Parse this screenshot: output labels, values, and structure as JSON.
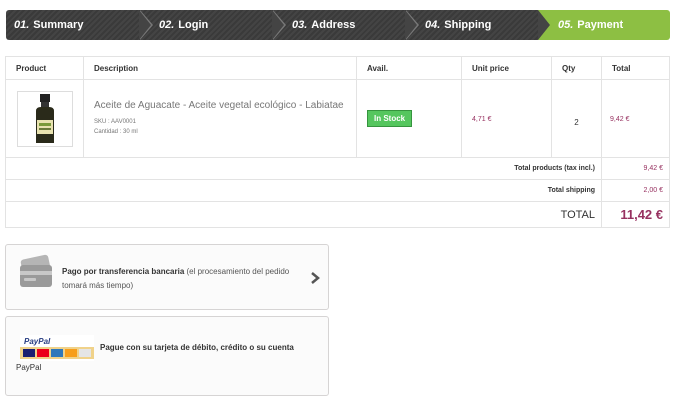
{
  "steps": [
    {
      "num": "01.",
      "label": "Summary"
    },
    {
      "num": "02.",
      "label": "Login"
    },
    {
      "num": "03.",
      "label": "Address"
    },
    {
      "num": "04.",
      "label": "Shipping"
    },
    {
      "num": "05.",
      "label": "Payment"
    }
  ],
  "colors": {
    "active_step": "#8dbf43",
    "price": "#973160",
    "stock": "#55c65e"
  },
  "table": {
    "headers": {
      "product": "Product",
      "description": "Description",
      "avail": "Avail.",
      "unit_price": "Unit price",
      "qty": "Qty",
      "total": "Total"
    },
    "item": {
      "name": "Aceite de Aguacate - Aceite vegetal ecológico - Labiatae",
      "sku": "SKU : AAV0001",
      "quantity_attr": "Cantidad : 30 ml",
      "availability": "In Stock",
      "unit_price": "4,71 €",
      "qty": "2",
      "total": "9,42 €",
      "image_icon": "product-bottle-icon"
    },
    "summary": {
      "products_label": "Total products (tax incl.)",
      "products_value": "9,42 €",
      "shipping_label": "Total shipping",
      "shipping_value": "2,00 €",
      "total_label": "TOTAL",
      "total_value": "11,42 €"
    }
  },
  "payment": {
    "bank": {
      "bold": "Pago por transferencia bancaria",
      "rest": " (el procesamiento del pedido tomará más tiempo)",
      "icon": "bank-card-icon"
    },
    "paypal": {
      "text": "Pague con su tarjeta de débito, crédito o su cuenta",
      "label": "PayPal",
      "logo_text": "PayPal"
    }
  }
}
